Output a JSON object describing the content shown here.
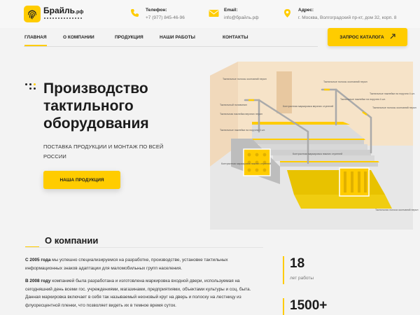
{
  "brand": {
    "name": "Брайль",
    "suffix": ".рф",
    "accent": "#ffcc00"
  },
  "contacts": {
    "phone": {
      "label": "Телефон:",
      "value": "+7 (977) 845-46-96",
      "icon": "phone-icon"
    },
    "email": {
      "label": "Email:",
      "value": "info@брайль.рф",
      "icon": "mail-icon"
    },
    "address": {
      "label": "Адрес:",
      "value": "г. Москва, Волгоградский пр-кт, дом 32, корп. 8",
      "icon": "location-icon"
    }
  },
  "nav": {
    "items": [
      {
        "label": "ГЛАВНАЯ",
        "active": true
      },
      {
        "label": "О КОМПАНИИ",
        "active": false
      },
      {
        "label": "ПРОДУКЦИЯ",
        "active": false
      },
      {
        "label": "НАШИ РАБОТЫ",
        "active": false
      },
      {
        "label": "КОНТАКТЫ",
        "active": false
      }
    ],
    "catalog_button": "ЗАПРОС КАТАЛОГА"
  },
  "hero": {
    "title_lines": [
      "Производство",
      "тактильного",
      "оборудования"
    ],
    "subtitle": "ПОСТАВКА ПРОДУКЦИИ И МОНТАЖ ПО ВСЕЙ РОССИИ",
    "button": "НАША ПРОДУКЦИЯ"
  },
  "illustration": {
    "labels": [
      "Тактильные полосы окончаний перил",
      "Тактильные полосы окончаний перил",
      "Тактильные наклейки на поручни 4 шт.",
      "Тактильные полосы окончаний перил",
      "Контрастная маркировка верхних ступеней",
      "Тактильные наклейки на поручни 4 шт.",
      "Тактильный поливинил",
      "Тактильная наклейка верхних перил",
      "Тактильные наклейки на поручни 4 шт.",
      "Контрастная маркировка нижних ступеней",
      "Контрастная маркировка нижних ступеней",
      "Тактильная полоса окончаний перил"
    ]
  },
  "about": {
    "title": "О компании",
    "p1_bold": "С 2005 года",
    "p1_rest": " мы успешно специализируемся на разработке, производстве, установке тактильных информационных знаков адаптации для маломобильных групп населения.",
    "p2_bold": "В 2008 году",
    "p2_rest": " компанией была разработана и изготовлена маркировка входной двери, используемая на сегодняшний день всеми гос. учреждениями, магазинами, предприятиями, объектами культуры и соц. быта. Данная маркировка включает в себя так называемый неоновый круг на дверь и полоску на лестницу из флуоресцентной пленки, что позволяет видеть их в темное время суток."
  },
  "stats": [
    {
      "number": "18",
      "caption": "лет работы"
    },
    {
      "number": "1500+",
      "caption": ""
    }
  ]
}
